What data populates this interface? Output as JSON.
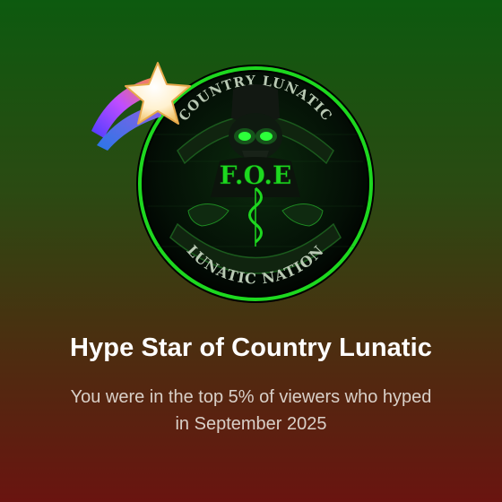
{
  "badge": {
    "top_text": "COUNTRY LUNATIC",
    "center_text": "F.O.E",
    "bottom_text": "LUNATIC NATION"
  },
  "achievement": {
    "title": "Hype Star of Country Lunatic",
    "subtitle": "You were in the top 5% of viewers who hyped in September 2025"
  },
  "icons": {
    "star": "shooting-star-icon",
    "channel": "channel-logo"
  },
  "colors": {
    "accent_green": "#1dd81f",
    "title_text": "#ffffff",
    "subtitle_text": "#d9d0c8"
  }
}
